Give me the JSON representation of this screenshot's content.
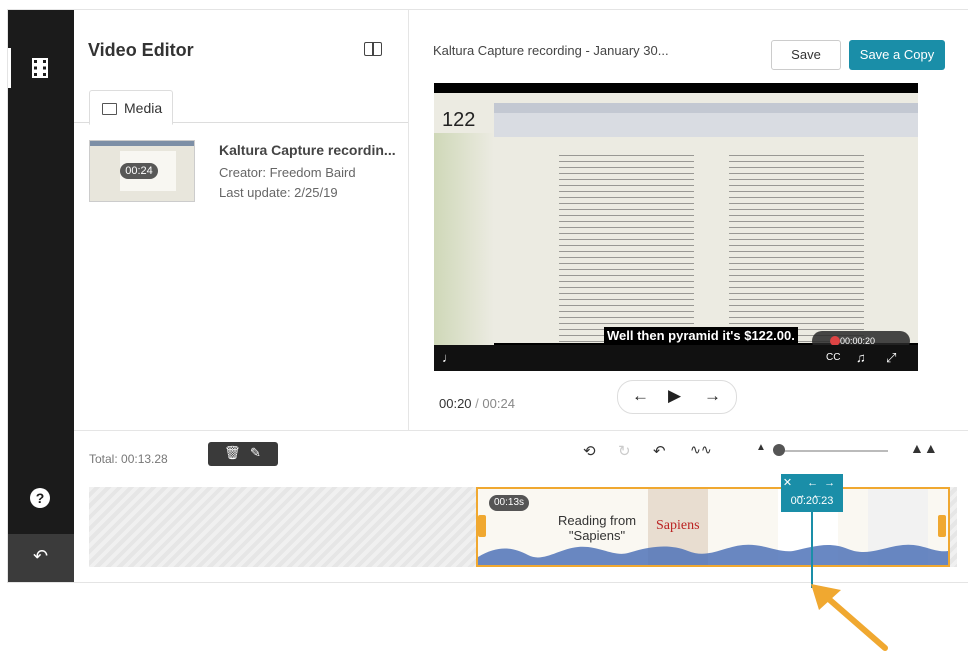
{
  "sidebar": {
    "help_label": "?",
    "back_label": "↶"
  },
  "media_panel": {
    "title": "Video Editor",
    "tab_media": "Media",
    "entry": {
      "thumb_duration": "00:24",
      "title": "Kaltura Capture recordin...",
      "creator": "Creator: Freedom Baird",
      "last_update": "Last update: 2/25/19"
    }
  },
  "player_panel": {
    "title": "Kaltura Capture recording - January 30...",
    "save_label": "Save",
    "save_copy_label": "Save a Copy",
    "video": {
      "page_number": "122",
      "caption": "Well then pyramid it's $122.00.",
      "rec_timer": "00:00:20"
    },
    "current_time": "00:20",
    "time_separator": "/",
    "total_time": "00:24"
  },
  "timeline": {
    "total": "Total: 00:13.28",
    "clip_badge": "00:13s",
    "clip_title_line1": "Reading from",
    "clip_title_line2": "\"Sapiens\"",
    "clip_book": "Sapiens",
    "playhead_tools": "✕ ←→ →←",
    "playhead_time": "00:20.23"
  },
  "colors": {
    "accent": "#1a8ea8",
    "clip_border": "#f0a830",
    "sidebar": "#1b1b1b",
    "annotation_arrow": "#f0a830"
  }
}
